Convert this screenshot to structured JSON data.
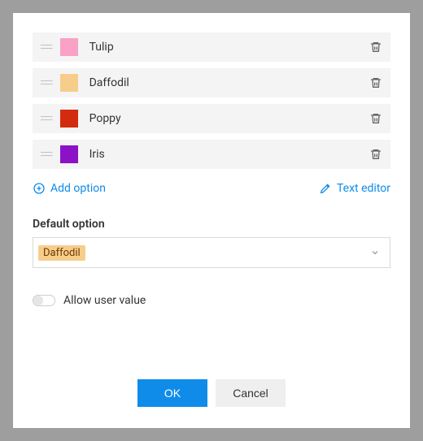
{
  "options": [
    {
      "label": "Tulip",
      "color": "#f9a1c6"
    },
    {
      "label": "Daffodil",
      "color": "#f7cd8b"
    },
    {
      "label": "Poppy",
      "color": "#d22b0e"
    },
    {
      "label": "Iris",
      "color": "#8c12c7"
    }
  ],
  "links": {
    "add_option": "Add option",
    "text_editor": "Text editor"
  },
  "default_section": {
    "label": "Default option",
    "selected": "Daffodil"
  },
  "allow_user_value": {
    "label": "Allow user value",
    "enabled": false
  },
  "buttons": {
    "ok": "OK",
    "cancel": "Cancel"
  }
}
